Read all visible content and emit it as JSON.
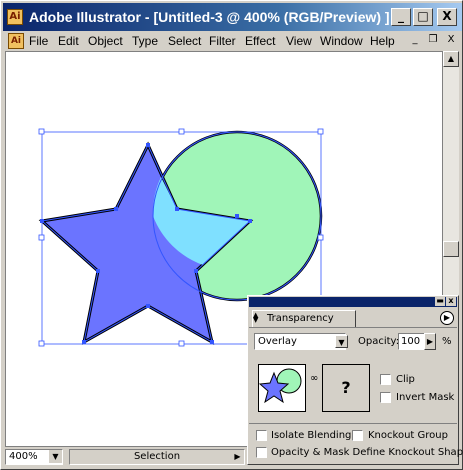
{
  "window": {
    "title": "Adobe Illustrator - [Untitled-3 @ 400% (RGB/Preview) ]",
    "buttons": [
      "_",
      "□",
      "X"
    ]
  },
  "menubar": {
    "items": [
      "File",
      "Edit",
      "Object",
      "Type",
      "Select",
      "Filter",
      "Effect",
      "View",
      "Window",
      "Help"
    ],
    "mdi_buttons": [
      "_",
      "❐",
      "X"
    ]
  },
  "canvas": {
    "star_color": "#6b74ff",
    "circle_color": "#a0f5b8",
    "overlap_color": "#7fe0ff",
    "selection_color": "#3355ff"
  },
  "statusbar": {
    "zoom": "400%",
    "status": "Selection"
  },
  "transparency_panel": {
    "tab_label": "Transparency",
    "blend_mode": "Overlay",
    "opacity_label": "Opacity:",
    "opacity_value": "100",
    "percent": "%",
    "mask_placeholder": "?",
    "clip_label": "Clip",
    "invert_mask_label": "Invert Mask",
    "isolate_blending_label": "Isolate Blending",
    "knockout_group_label": "Knockout Group",
    "opacity_mask_label": "Opacity & Mask Define Knockout Shape"
  }
}
